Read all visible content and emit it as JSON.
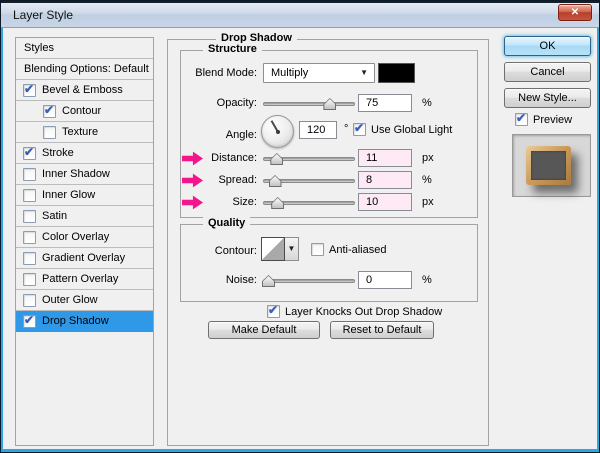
{
  "icons": {
    "check": "✔",
    "combo_arrow": "▼",
    "close": "✕"
  },
  "colors": {
    "selection_blue": "#2f99e8",
    "highlight_pink": "#fdeaf4",
    "arrow_pink": "#f2158c",
    "swatch_black": "#000000",
    "accent_blue": "#2ca6e4"
  },
  "window": {
    "title": "Layer Style"
  },
  "sidebar": {
    "header": "Styles",
    "items": [
      {
        "label": "Blending Options: Default"
      },
      {
        "label": "Bevel & Emboss"
      },
      {
        "label": "Contour"
      },
      {
        "label": "Texture"
      },
      {
        "label": "Stroke"
      },
      {
        "label": "Inner Shadow"
      },
      {
        "label": "Inner Glow"
      },
      {
        "label": "Satin"
      },
      {
        "label": "Color Overlay"
      },
      {
        "label": "Gradient Overlay"
      },
      {
        "label": "Pattern Overlay"
      },
      {
        "label": "Outer Glow"
      },
      {
        "label": "Drop Shadow"
      }
    ]
  },
  "panel": {
    "title": "Drop Shadow",
    "structure": {
      "title": "Structure",
      "blend_mode_label": "Blend Mode:",
      "blend_mode_value": "Multiply",
      "opacity_label": "Opacity:",
      "opacity_value": "75",
      "opacity_unit": "%",
      "angle_label": "Angle:",
      "angle_value": "120",
      "angle_unit": "°",
      "use_global_light": "Use Global Light",
      "distance_label": "Distance:",
      "distance_value": "11",
      "distance_unit": "px",
      "spread_label": "Spread:",
      "spread_value": "8",
      "spread_unit": "%",
      "size_label": "Size:",
      "size_value": "10",
      "size_unit": "px"
    },
    "quality": {
      "title": "Quality",
      "contour_label": "Contour:",
      "anti_aliased": "Anti-aliased",
      "noise_label": "Noise:",
      "noise_value": "0",
      "noise_unit": "%"
    },
    "knockout": "Layer Knocks Out Drop Shadow",
    "make_default": "Make Default",
    "reset_default": "Reset to Default"
  },
  "actions": {
    "ok": "OK",
    "cancel": "Cancel",
    "new_style": "New Style...",
    "preview": "Preview"
  }
}
